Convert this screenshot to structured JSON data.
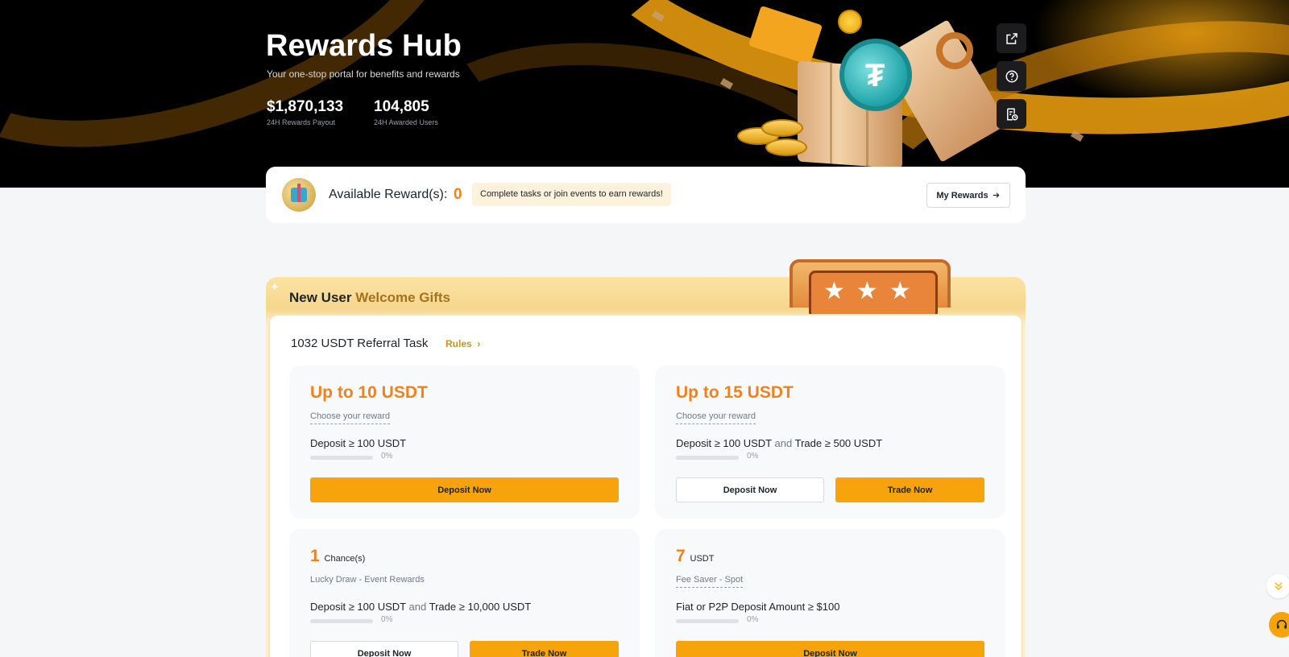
{
  "hero": {
    "title": "Rewards Hub",
    "subtitle": "Your one-stop portal for benefits and rewards",
    "stats": [
      {
        "value": "$1,870,133",
        "label": "24H Rewards Payout"
      },
      {
        "value": "104,805",
        "label": "24H Awarded Users"
      }
    ],
    "side_buttons": [
      "external-link-icon",
      "help-icon",
      "rewards-history-icon"
    ]
  },
  "available": {
    "label": "Available Reward(s):",
    "count": "0",
    "hint": "Complete tasks or join events to earn rewards!",
    "my_rewards": "My Rewards"
  },
  "welcome": {
    "title_a": "New User",
    "title_b": "Welcome Gifts",
    "task_title": "1032 USDT Referral Task",
    "rules": "Rules",
    "cards": [
      {
        "headline": "Up to 10 USDT",
        "sub": "Choose your reward",
        "req_a": "Deposit ≥ 100 USDT",
        "progress": 0,
        "pct": "0%",
        "btn_primary": "Deposit Now"
      },
      {
        "headline": "Up to 15 USDT",
        "sub": "Choose your reward",
        "req_a": "Deposit ≥ 100 USDT",
        "req_and": "and",
        "req_b": "Trade ≥ 500 USDT",
        "progress": 0,
        "pct": "0%",
        "btn_ghost": "Deposit Now",
        "btn_primary": "Trade Now"
      },
      {
        "headline_num": "1",
        "headline_unit": "Chance(s)",
        "sub": "Lucky Draw - Event Rewards",
        "req_a": "Deposit ≥ 100 USDT",
        "req_and": "and",
        "req_b": "Trade ≥ 10,000 USDT",
        "progress": 0,
        "pct": "0%",
        "btn_ghost": "Deposit Now",
        "btn_primary": "Trade Now"
      },
      {
        "headline_num": "7",
        "headline_unit": "USDT",
        "sub": "Fee Saver - Spot",
        "req_a": "Fiat or P2P Deposit Amount ≥ $100",
        "progress": 0,
        "pct": "0%",
        "btn_primary": "Deposit Now"
      }
    ]
  },
  "floating": [
    "scroll-down-icon",
    "support-icon"
  ],
  "colors": {
    "accent": "#f7a30b",
    "orange": "#f0821e",
    "gold": "#a4721a"
  }
}
